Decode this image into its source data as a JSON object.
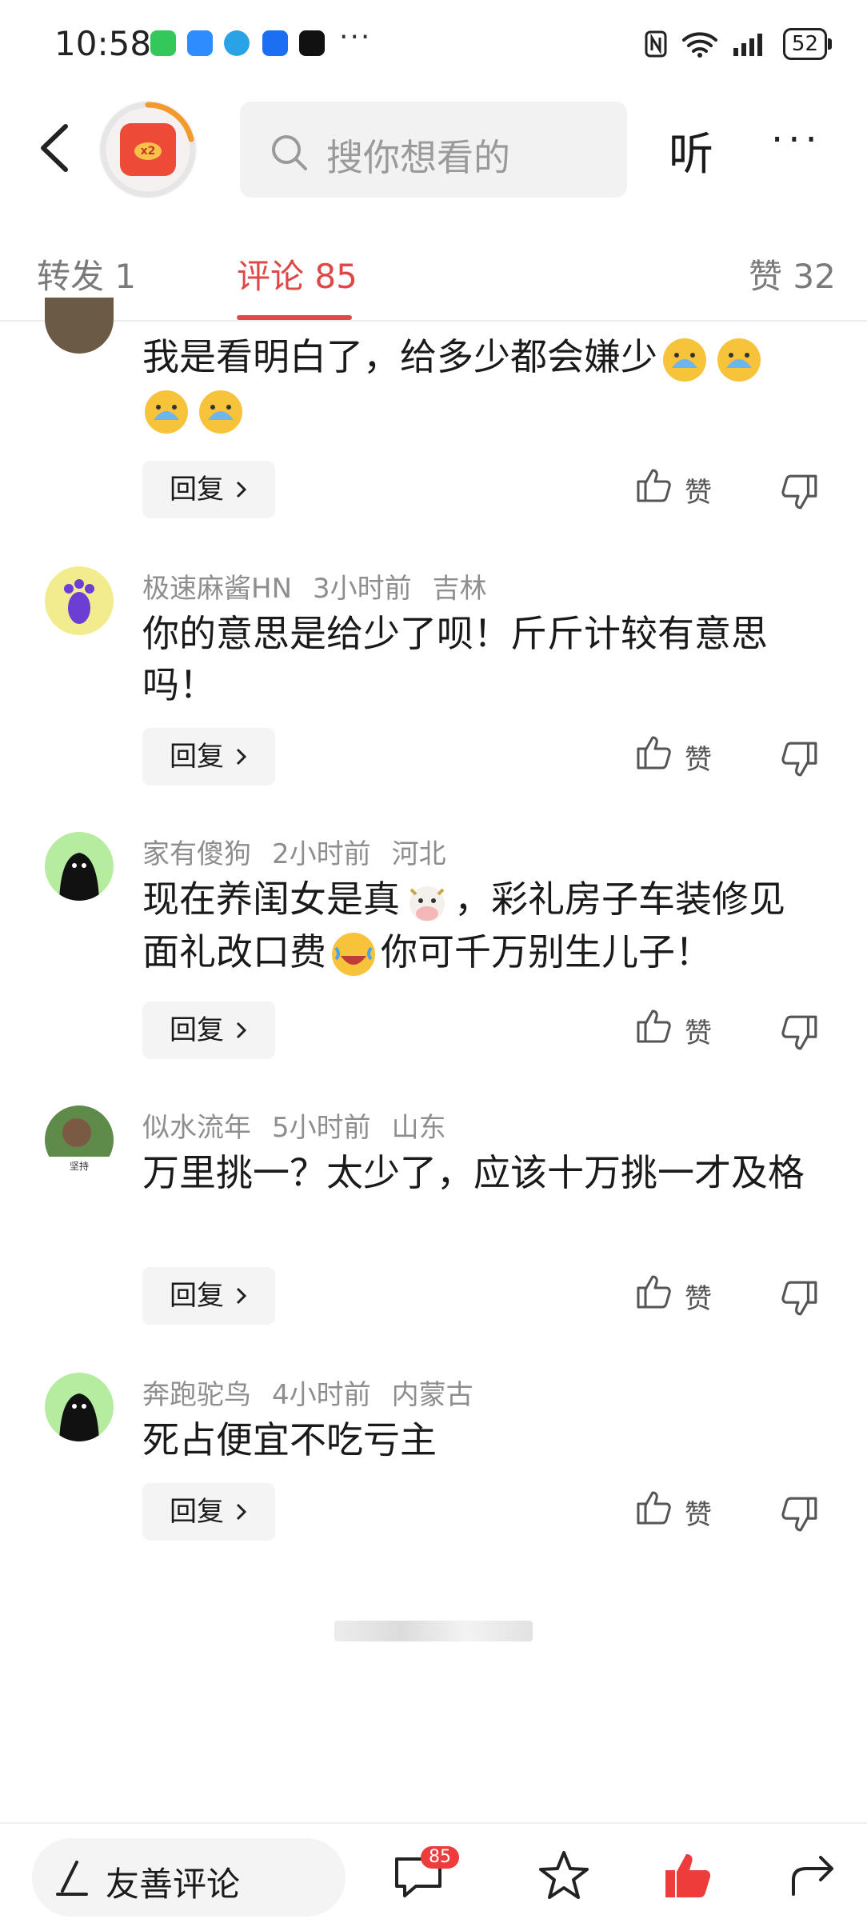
{
  "status_bar": {
    "time": "10:58",
    "battery": "52"
  },
  "header": {
    "search_placeholder": "搜你想看的",
    "listen_label": "听",
    "more_label": "···",
    "reward_badge": "x2"
  },
  "tabs": [
    {
      "label": "转发 1"
    },
    {
      "label": "评论 85"
    },
    {
      "label": "赞 32"
    }
  ],
  "comments": [
    {
      "author": "",
      "time": "",
      "location": "",
      "text": "我是看明白了，给多少都会嫌少",
      "emojis": [
        "crying-face-emoji",
        "crying-face-emoji",
        "crying-face-emoji",
        "crying-face-emoji"
      ],
      "reply": "回复",
      "like": "赞"
    },
    {
      "author": "极速麻酱HN",
      "time": "3小时前",
      "location": "吉林",
      "text": "你的意思是给少了呗！斤斤计较有意思吗！",
      "reply": "回复",
      "like": "赞"
    },
    {
      "author": "家有傻狗",
      "time": "2小时前",
      "location": "河北",
      "text_a": "现在养闺女是真",
      "text_b": "，彩礼房子车装修见面礼改口费",
      "text_c": "你可千万别生儿子！",
      "reply": "回复",
      "like": "赞"
    },
    {
      "author": "似水流年",
      "time": "5小时前",
      "location": "山东",
      "text": "万里挑一？太少了，应该十万挑一才及格",
      "avatar_caption": "坚持",
      "reply": "回复",
      "like": "赞"
    },
    {
      "author": "奔跑驼鸟",
      "time": "4小时前",
      "location": "内蒙古",
      "text": "死占便宜不吃亏主",
      "reply": "回复",
      "like": "赞"
    }
  ],
  "bottom_bar": {
    "input_label": "友善评论",
    "comment_count": "85"
  },
  "colors": {
    "accent": "#e04848",
    "like_active": "#ee3b3b"
  }
}
